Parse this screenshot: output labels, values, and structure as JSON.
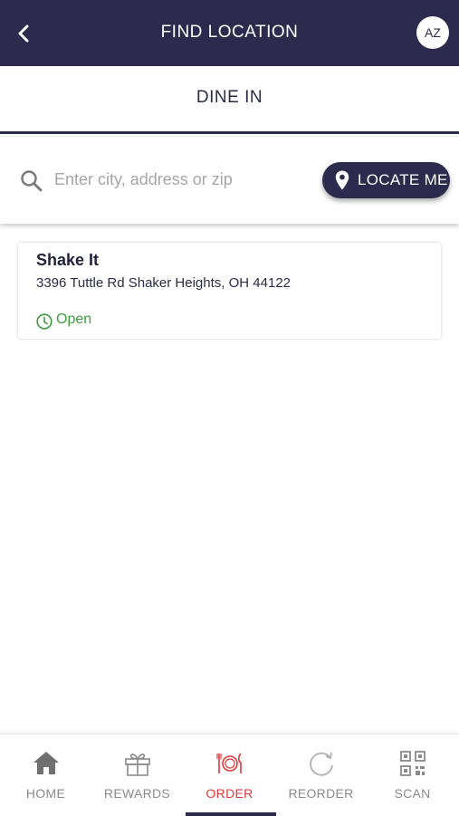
{
  "header": {
    "title": "FIND LOCATION",
    "avatar_initials": "AZ",
    "back_icon": "chevron-left-icon"
  },
  "mode": {
    "label": "DINE IN"
  },
  "search": {
    "placeholder": "Enter city, address or zip",
    "value": "",
    "locate_label": "LOCATE ME"
  },
  "locations": [
    {
      "name": "Shake It",
      "address": "3396 Tuttle Rd Shaker Heights, OH 44122",
      "status": "Open"
    }
  ],
  "tabs": [
    {
      "label": "HOME",
      "icon": "home-icon",
      "active": false
    },
    {
      "label": "REWARDS",
      "icon": "gift-icon",
      "active": false
    },
    {
      "label": "ORDER",
      "icon": "order-utensils-icon",
      "active": true
    },
    {
      "label": "REORDER",
      "icon": "reorder-icon",
      "active": false
    },
    {
      "label": "SCAN",
      "icon": "qr-code-icon",
      "active": false
    }
  ],
  "colors": {
    "primary": "#2c2b4d",
    "accent": "#e0373b",
    "open": "#3f9b3f",
    "inactive": "#8a8a8a"
  }
}
